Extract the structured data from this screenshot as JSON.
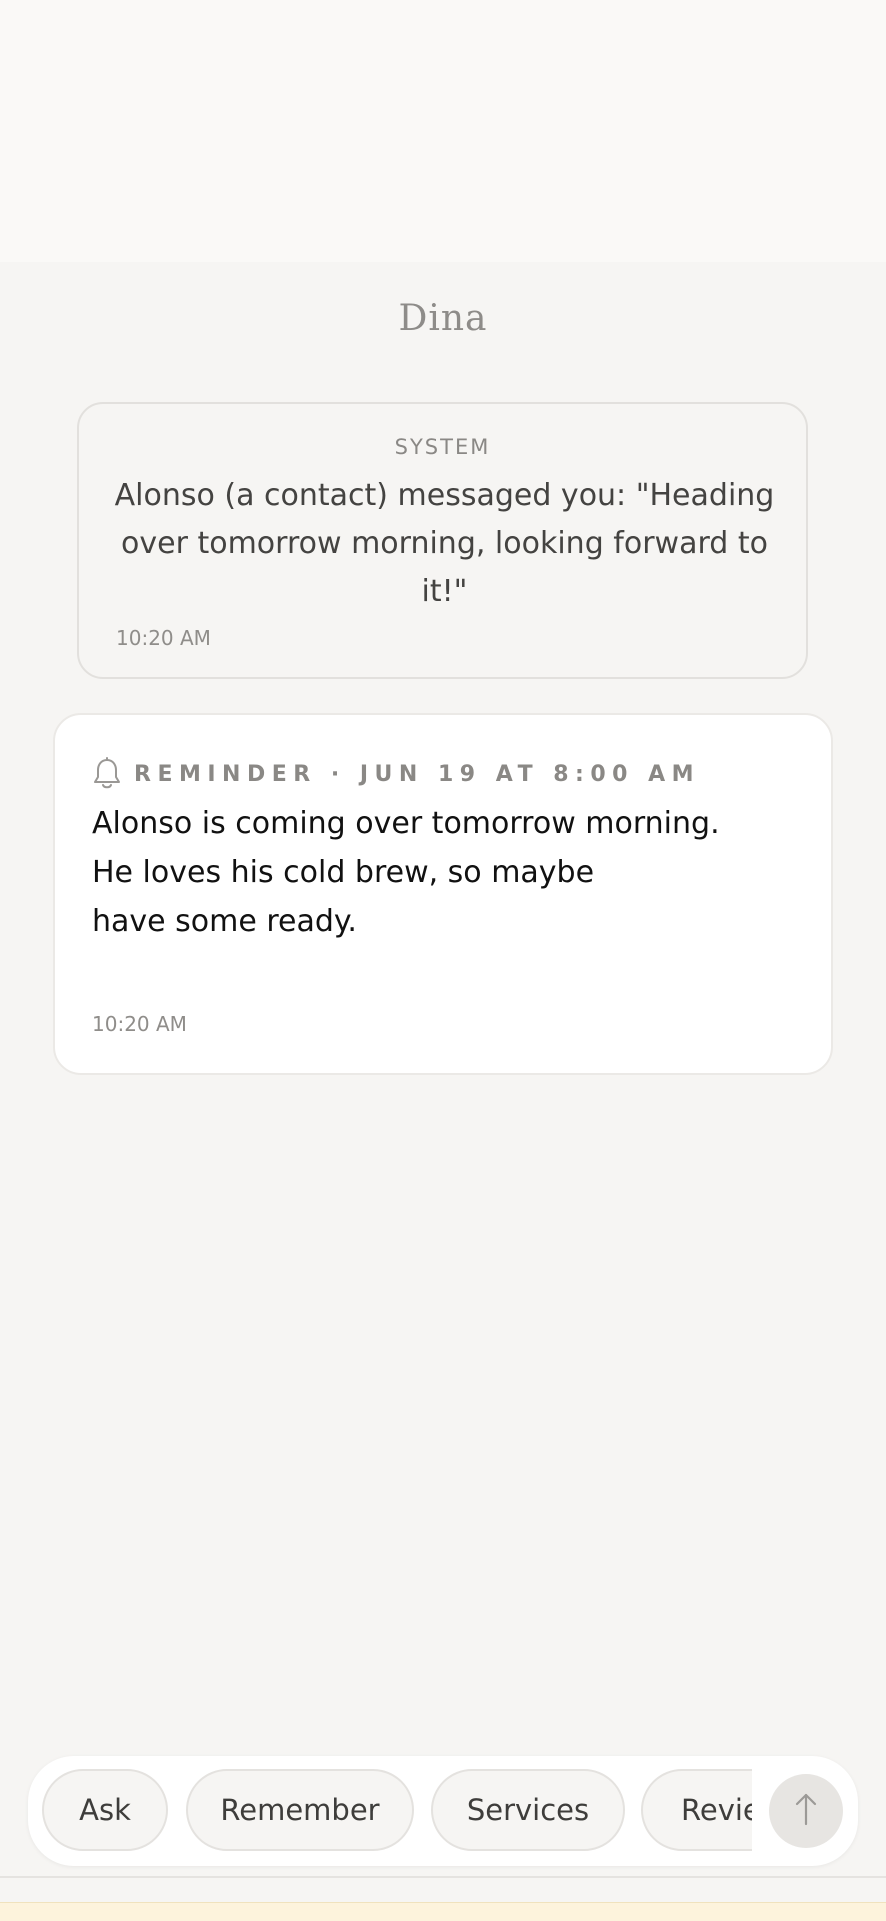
{
  "header": {
    "title": "Dina"
  },
  "system_message": {
    "label": "SYSTEM",
    "text": "Alonso (a contact) messaged you: \"Heading over tomorrow morning, looking forward to it!\"",
    "time": "10:20 AM"
  },
  "reminder": {
    "icon": "bell-icon",
    "label": "REMINDER · JUN 19 AT 8:00 AM",
    "lines": [
      "Alonso is coming over tomorrow morning.",
      "He loves his cold brew, so maybe",
      "have some ready."
    ],
    "time": "10:20 AM"
  },
  "action_bar": {
    "pills": [
      "Ask",
      "Remember",
      "Services",
      "Review"
    ],
    "send_icon": "arrow-up-icon"
  },
  "colors": {
    "background": "#f6f5f3",
    "card": "#ffffff",
    "muted_text": "#8a8885",
    "bottom_strip": "#fdf3dc"
  }
}
